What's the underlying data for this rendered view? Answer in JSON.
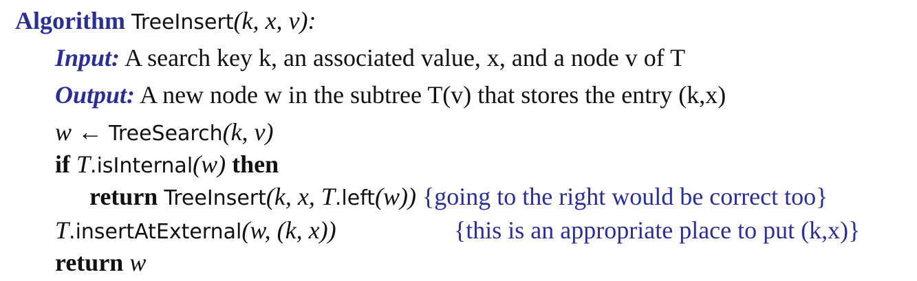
{
  "header": {
    "keyword": "Algorithm",
    "name": "TreeInsert",
    "params": "(k, x, v):"
  },
  "input_line": {
    "label": "Input:",
    "text": "A search key k, an associated value, x, and a node v of T"
  },
  "output_line": {
    "label": "Output:",
    "text": "A new node w in the subtree T(v) that stores the entry (k,x)"
  },
  "lines": {
    "assign_var": "w",
    "assign_arrow": "←",
    "assign_call": "TreeSearch",
    "assign_args": "(k, v)",
    "if_kw": "if",
    "if_obj": "T",
    "if_method": ".isInternal",
    "if_args": "(w)",
    "then_kw": "then",
    "return_kw": "return",
    "return_call": "TreeInsert",
    "return_args_pre": "(k, x, ",
    "return_obj": "T",
    "return_method": ".left",
    "return_args_post": "(w))",
    "return_comment": "{going to the right would be correct too}",
    "insert_obj": "T",
    "insert_method": ".insertAtExternal",
    "insert_args": "(w, (k, x))",
    "insert_comment": "{this is an appropriate place to put (k,x)}",
    "final_return_kw": "return",
    "final_return_var": "w"
  }
}
